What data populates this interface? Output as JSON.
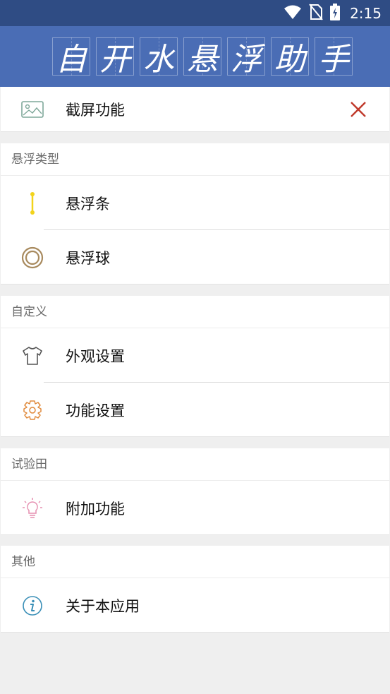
{
  "status_bar": {
    "time": "2:15"
  },
  "app_bar": {
    "title_chars": [
      "自",
      "开",
      "水",
      "悬",
      "浮",
      "助",
      "手"
    ]
  },
  "screenshot_item": {
    "label": "截屏功能"
  },
  "float_section": {
    "header": "悬浮类型",
    "items": [
      {
        "label": "悬浮条"
      },
      {
        "label": "悬浮球"
      }
    ]
  },
  "custom_section": {
    "header": "自定义",
    "items": [
      {
        "label": "外观设置"
      },
      {
        "label": "功能设置"
      }
    ]
  },
  "lab_section": {
    "header": "试验田",
    "items": [
      {
        "label": "附加功能"
      }
    ]
  },
  "other_section": {
    "header": "其他",
    "items": [
      {
        "label": "关于本应用"
      }
    ]
  },
  "colors": {
    "status_bar": "#2f4c84",
    "app_bar": "#4a6db5",
    "close": "#c0392b",
    "float_bar": "#f2d31b",
    "float_ball": "#a88a5e",
    "appearance": "#555555",
    "settings": "#e08a3c",
    "bulb": "#e58fb0",
    "info": "#3a8fb7"
  }
}
